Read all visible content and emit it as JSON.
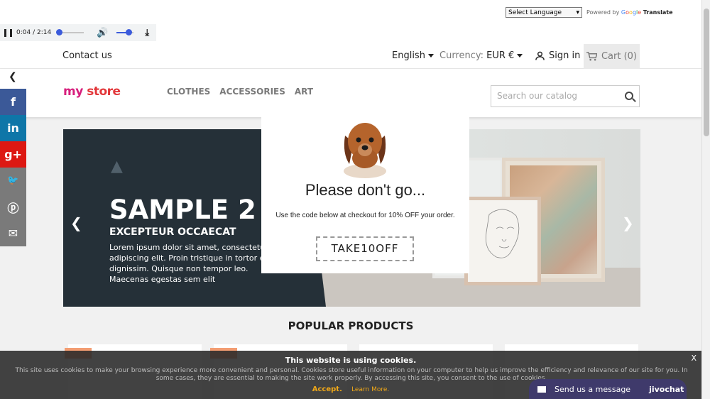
{
  "translate": {
    "select_label": "Select Language",
    "powered_prefix": "Powered by",
    "google": [
      "G",
      "o",
      "o",
      "g",
      "l",
      "e"
    ],
    "translate_word": "Translate"
  },
  "audio": {
    "time": "0:04 / 2:14",
    "progress": 0.03,
    "volume": 0.7
  },
  "header": {
    "contact": "Contact us",
    "language": "English",
    "currency_label": "Currency:",
    "currency_value": "EUR €",
    "signin": "Sign in",
    "cart": "Cart (0)"
  },
  "logo": {
    "part1": "my",
    "part2": "store"
  },
  "menu": [
    "CLOTHES",
    "ACCESSORIES",
    "ART"
  ],
  "search": {
    "placeholder": "Search our catalog"
  },
  "social": [
    {
      "icon": "facebook-icon",
      "glyph": "f",
      "color": "#3b5998"
    },
    {
      "icon": "linkedin-icon",
      "glyph": "in",
      "color": "#0e76a8"
    },
    {
      "icon": "googleplus-icon",
      "glyph": "g+",
      "color": "#dd1812"
    },
    {
      "icon": "twitter-icon",
      "glyph": "🐦",
      "color": "#7a7a7a"
    },
    {
      "icon": "pinterest-icon",
      "glyph": "ⓟ",
      "color": "#7a7a7a"
    },
    {
      "icon": "email-icon",
      "glyph": "✉",
      "color": "#7a7a7a"
    }
  ],
  "hero": {
    "title": "SAMPLE 2",
    "subtitle": "EXCEPTEUR OCCAECAT",
    "text": "Lorem ipsum dolor sit amet, consectetur adipiscing elit. Proin tristique in tortor et dignissim. Quisque non tempor leo. Maecenas egestas sem elit"
  },
  "popular_title": "POPULAR PRODUCTS",
  "popup": {
    "title": "Please don't go...",
    "text": "Use the code below at checkout for 10% OFF your order.",
    "code": "TAKE10OFF"
  },
  "cookie": {
    "title": "This website is using cookies.",
    "text": "This site uses cookies to make your browsing experience more convenient and personal. Cookies store useful information on your computer to help us improve the efficiency and relevance of our site for you. In some cases, they are essential to making the site work properly. By accessing this site, you consent to the use of cookies.",
    "accept": "Accept.",
    "learn": "Learn More.",
    "close": "X"
  },
  "chat": {
    "label": "Send us a message",
    "brand": "jivochat"
  },
  "colors": {
    "dark_slide": "#253038",
    "accent": "#f0a818",
    "chat_bg": "#3f3a6b"
  }
}
